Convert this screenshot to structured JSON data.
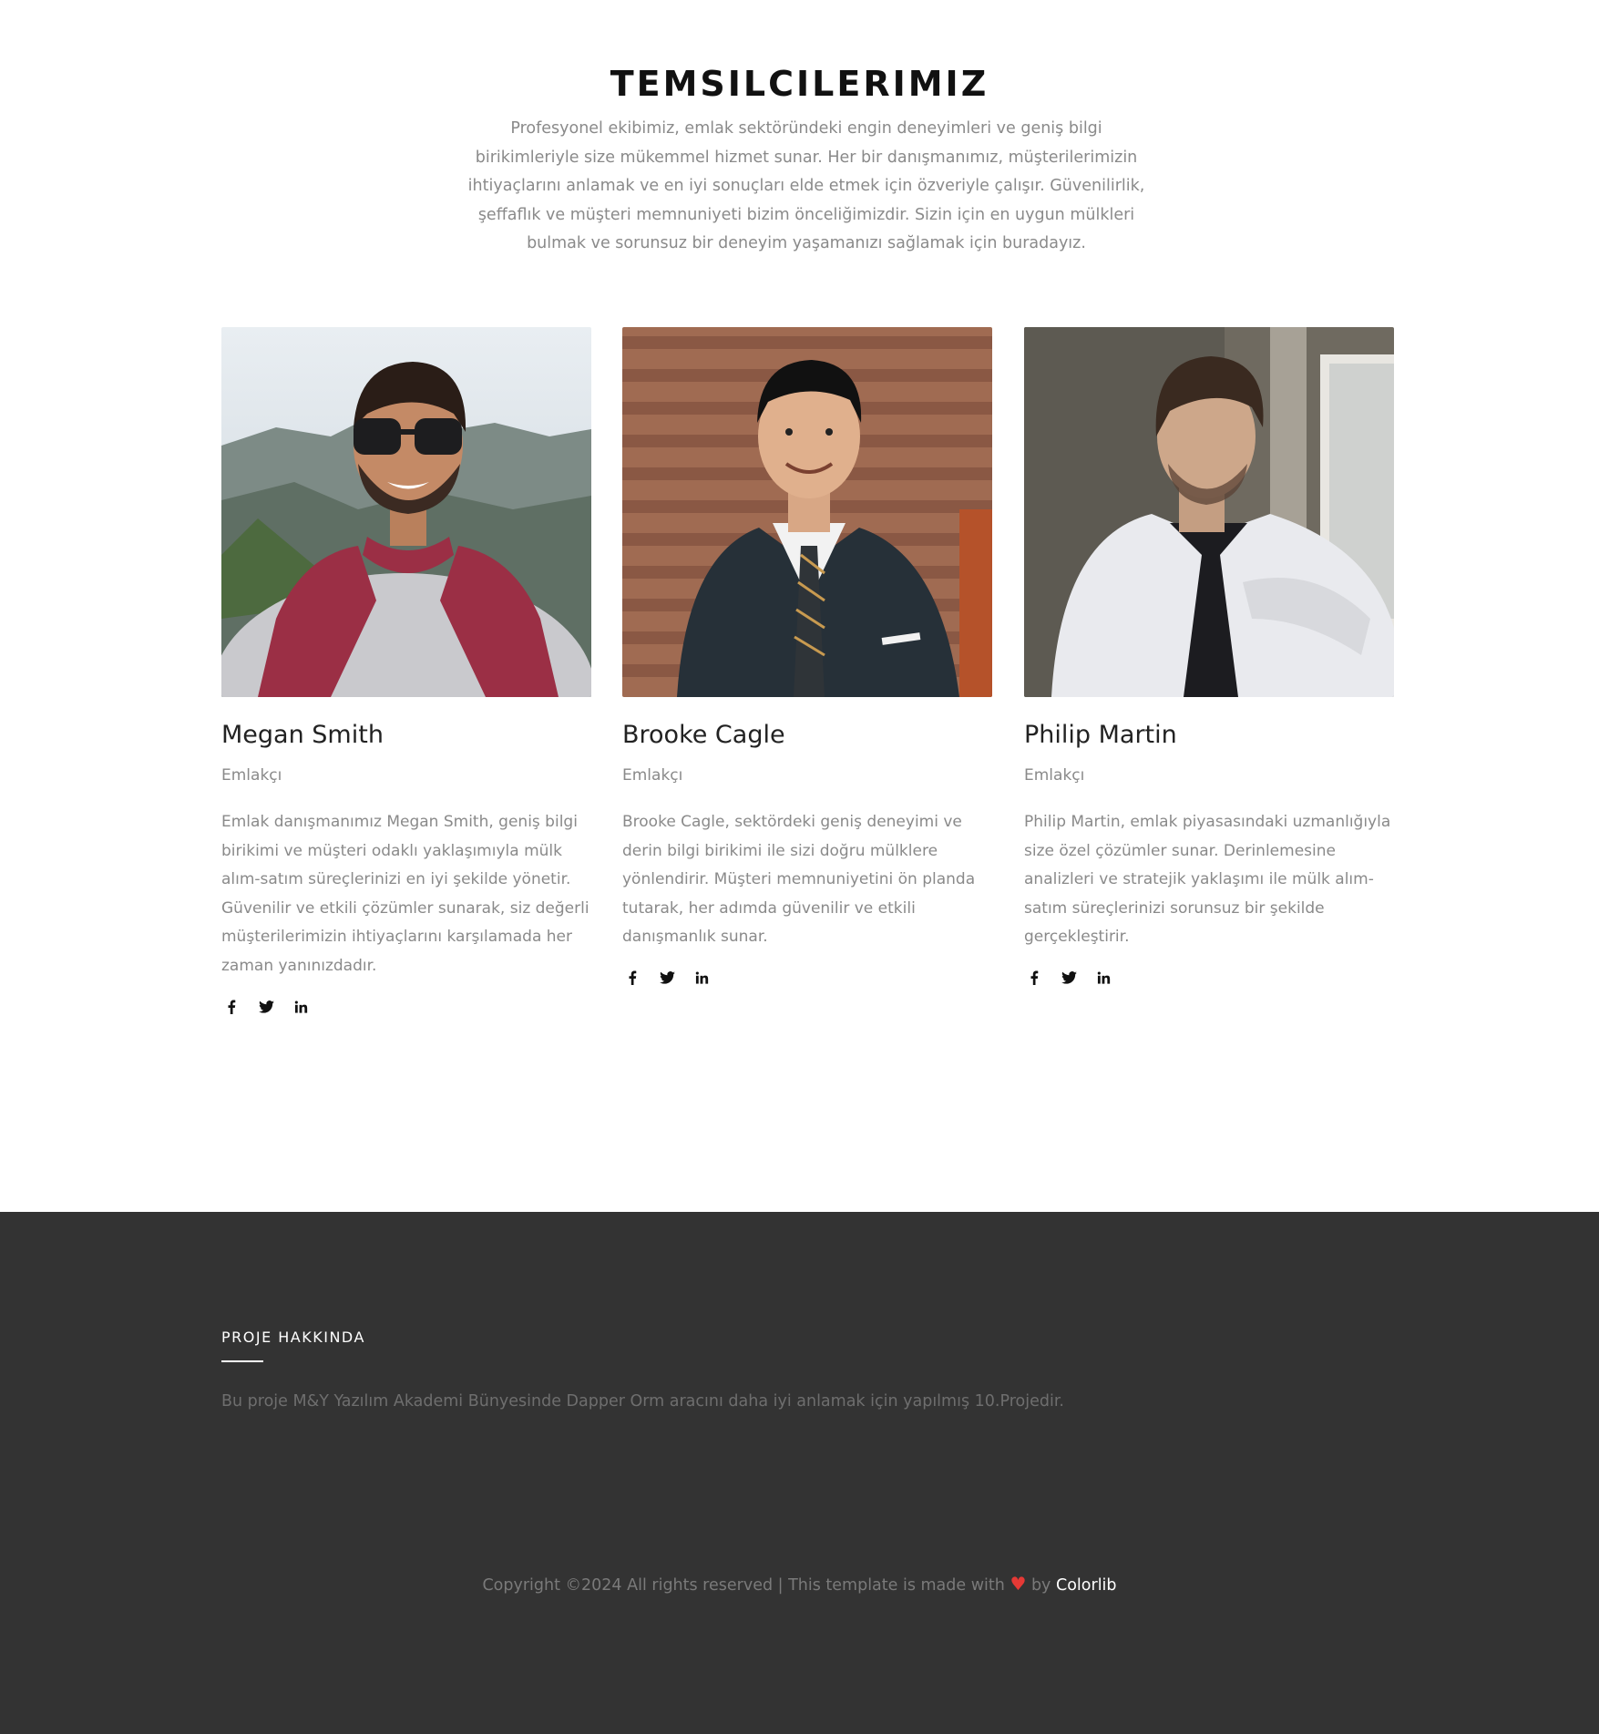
{
  "agents": {
    "title": "TEMSILCILERIMIZ",
    "intro": "Profesyonel ekibimiz, emlak sektöründeki engin deneyimleri ve geniş bilgi birikimleriyle size mükemmel hizmet sunar. Her bir danışmanımız, müşterilerimizin ihtiyaçlarını anlamak ve en iyi sonuçları elde etmek için özveriyle çalışır. Güvenilirlik, şeffaflık ve müşteri memnuniyeti bizim önceliğimizdir. Sizin için en uygun mülkleri bulmak ve sorunsuz bir deneyim yaşamanızı sağlamak için buradayız.",
    "members": [
      {
        "name": "Megan Smith",
        "role": "Emlakçı",
        "bio": "Emlak danışmanımız Megan Smith, geniş bilgi birikimi ve müşteri odaklı yaklaşımıyla mülk alım-satım süreçlerinizi en iyi şekilde yönetir. Güvenilir ve etkili çözümler sunarak, siz değerli müşterilerimizin ihtiyaçlarını karşılamada her zaman yanınızdadır."
      },
      {
        "name": "Brooke Cagle",
        "role": "Emlakçı",
        "bio": "Brooke Cagle, sektördeki geniş deneyimi ve derin bilgi birikimi ile sizi doğru mülklere yönlendirir. Müşteri memnuniyetini ön planda tutarak, her adımda güvenilir ve etkili danışmanlık sunar."
      },
      {
        "name": "Philip Martin",
        "role": "Emlakçı",
        "bio": "Philip Martin, emlak piyasasındaki uzmanlığıyla size özel çözümler sunar. Derinlemesine analizleri ve stratejik yaklaşımı ile mülk alım-satım süreçlerinizi sorunsuz bir şekilde gerçekleştirir."
      }
    ],
    "social_icons": [
      "facebook-icon",
      "twitter-icon",
      "linkedin-icon"
    ]
  },
  "footer": {
    "heading": "PROJE HAKKINDA",
    "text": "Bu proje M&Y Yazılım Akademi Bünyesinde Dapper Orm aracını daha iyi anlamak için yapılmış 10.Projedir.",
    "copyright_prefix": "Copyright ©2024 All rights reserved | This template is made with",
    "heart": "♥",
    "copyright_by": "by",
    "brand": "Colorlib"
  },
  "colors": {
    "footer_bg": "#333333",
    "heart": "#e53935",
    "body_text": "#8a8a8a"
  }
}
